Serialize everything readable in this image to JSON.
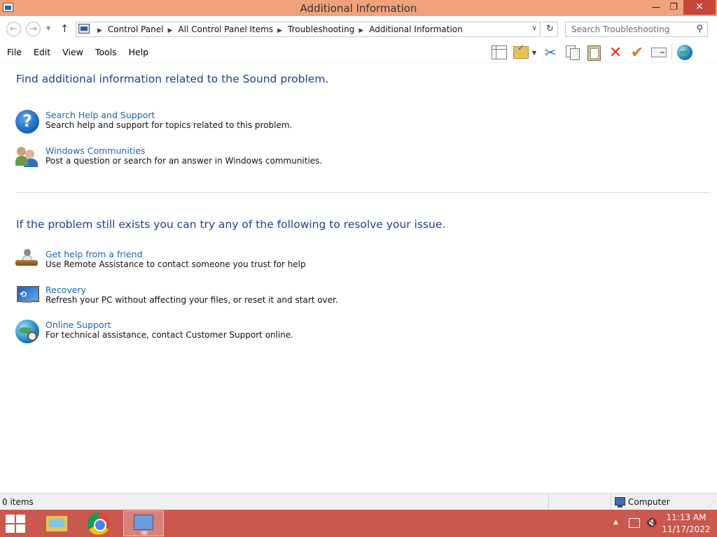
{
  "window": {
    "title": "Additional Information",
    "minimize_glyph": "—",
    "restore_glyph": "❐",
    "close_glyph": "✕"
  },
  "address_bar": {
    "back_glyph": "←",
    "forward_glyph": "→",
    "recent_glyph": "▼",
    "up_glyph": "↑",
    "breadcrumbs": [
      "Control Panel",
      "All Control Panel Items",
      "Troubleshooting",
      "Additional Information"
    ],
    "separator": "▶",
    "dropdown_glyph": "∨",
    "refresh_glyph": "↻",
    "search_placeholder": "Search Troubleshooting",
    "search_glyph": "⚲"
  },
  "menu": {
    "items": [
      "File",
      "Edit",
      "View",
      "Tools",
      "Help"
    ]
  },
  "toolbar": {
    "cut_glyph": "✂",
    "delete_glyph": "✕",
    "check_glyph": "✔",
    "drop_glyph": "▼"
  },
  "content": {
    "heading1": "Find additional information related to the Sound problem.",
    "heading2": "If the problem still exists you can try any of the following to resolve your issue.",
    "items": [
      {
        "link": "Search Help and Support",
        "desc": "Search help and support for topics related to this problem.",
        "icon_glyph": "?"
      },
      {
        "link": "Windows Communities",
        "desc": "Post a question or search for an answer in Windows communities."
      },
      {
        "link": "Get help from a friend",
        "desc": "Use Remote Assistance to contact someone you trust for help"
      },
      {
        "link": "Recovery",
        "desc": "Refresh your PC without affecting your files, or reset it and start over.",
        "icon_glyph": "⟲"
      },
      {
        "link": "Online Support",
        "desc": "For technical assistance, contact Customer Support online."
      }
    ]
  },
  "status_bar": {
    "count": "0 items",
    "location": "Computer",
    "grip_glyph": "⋰"
  },
  "taskbar": {
    "tray_arrow_glyph": "▲",
    "volume_glyph": "🔇",
    "time": "11:13 AM",
    "date": "11/17/2022"
  },
  "colors": {
    "titlebar": "#f0a27c",
    "taskbar": "#c9584e",
    "heading": "#1e3f8f",
    "link": "#1c62b4"
  }
}
